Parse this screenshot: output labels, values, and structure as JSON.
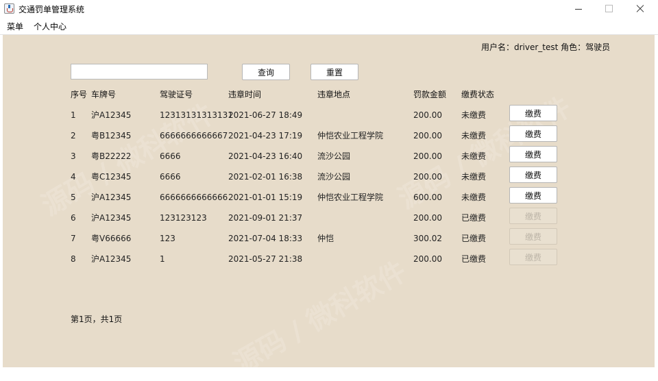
{
  "window": {
    "title": "交通罚单管理系统"
  },
  "menu": {
    "items": [
      "菜单",
      "个人中心"
    ]
  },
  "user_info": "用户名：driver_test 角色：驾驶员",
  "search": {
    "value": "",
    "placeholder": ""
  },
  "buttons": {
    "query": "查询",
    "reset": "重置"
  },
  "table": {
    "headers": [
      "序号",
      "车牌号",
      "驾驶证号",
      "违章时间",
      "违章地点",
      "罚款金额",
      "缴费状态"
    ],
    "action_label": "缴费",
    "rows": [
      {
        "id": "1",
        "plate": "沪A12345",
        "license": "12313131313131",
        "time": "2021-06-27 18:49",
        "location": "",
        "amount": "200.00",
        "status": "未缴费",
        "payable": true
      },
      {
        "id": "2",
        "plate": "粤B12345",
        "license": "6666666666667",
        "time": "2021-04-23 17:19",
        "location": "仲恺农业工程学院",
        "amount": "200.00",
        "status": "未缴费",
        "payable": true
      },
      {
        "id": "3",
        "plate": "粤B22222",
        "license": "6666",
        "time": "2021-04-23 16:40",
        "location": "流沙公园",
        "amount": "200.00",
        "status": "未缴费",
        "payable": true
      },
      {
        "id": "4",
        "plate": "粤C12345",
        "license": "6666",
        "time": "2021-02-01 16:38",
        "location": "流沙公园",
        "amount": "200.00",
        "status": "未缴费",
        "payable": true
      },
      {
        "id": "5",
        "plate": "沪A12345",
        "license": "6666666666666",
        "time": "2021-01-01 15:19",
        "location": "仲恺农业工程学院",
        "amount": "600.00",
        "status": "未缴费",
        "payable": true
      },
      {
        "id": "6",
        "plate": "沪A12345",
        "license": "123123123",
        "time": "2021-09-01 21:37",
        "location": "",
        "amount": "200.00",
        "status": "已缴费",
        "payable": false
      },
      {
        "id": "7",
        "plate": "粤V66666",
        "license": "123",
        "time": "2021-07-04 18:33",
        "location": "仲恺",
        "amount": "300.02",
        "status": "已缴费",
        "payable": false
      },
      {
        "id": "8",
        "plate": "沪A12345",
        "license": "1",
        "time": "2021-05-27 21:38",
        "location": "",
        "amount": "200.00",
        "status": "已缴费",
        "payable": false
      }
    ]
  },
  "pagination": {
    "text": "第1页，共1页"
  },
  "watermark_text": "源码 / 微科软件",
  "colors": {
    "content_bg": "#e7dcca",
    "window_bg": "#ffffff"
  }
}
